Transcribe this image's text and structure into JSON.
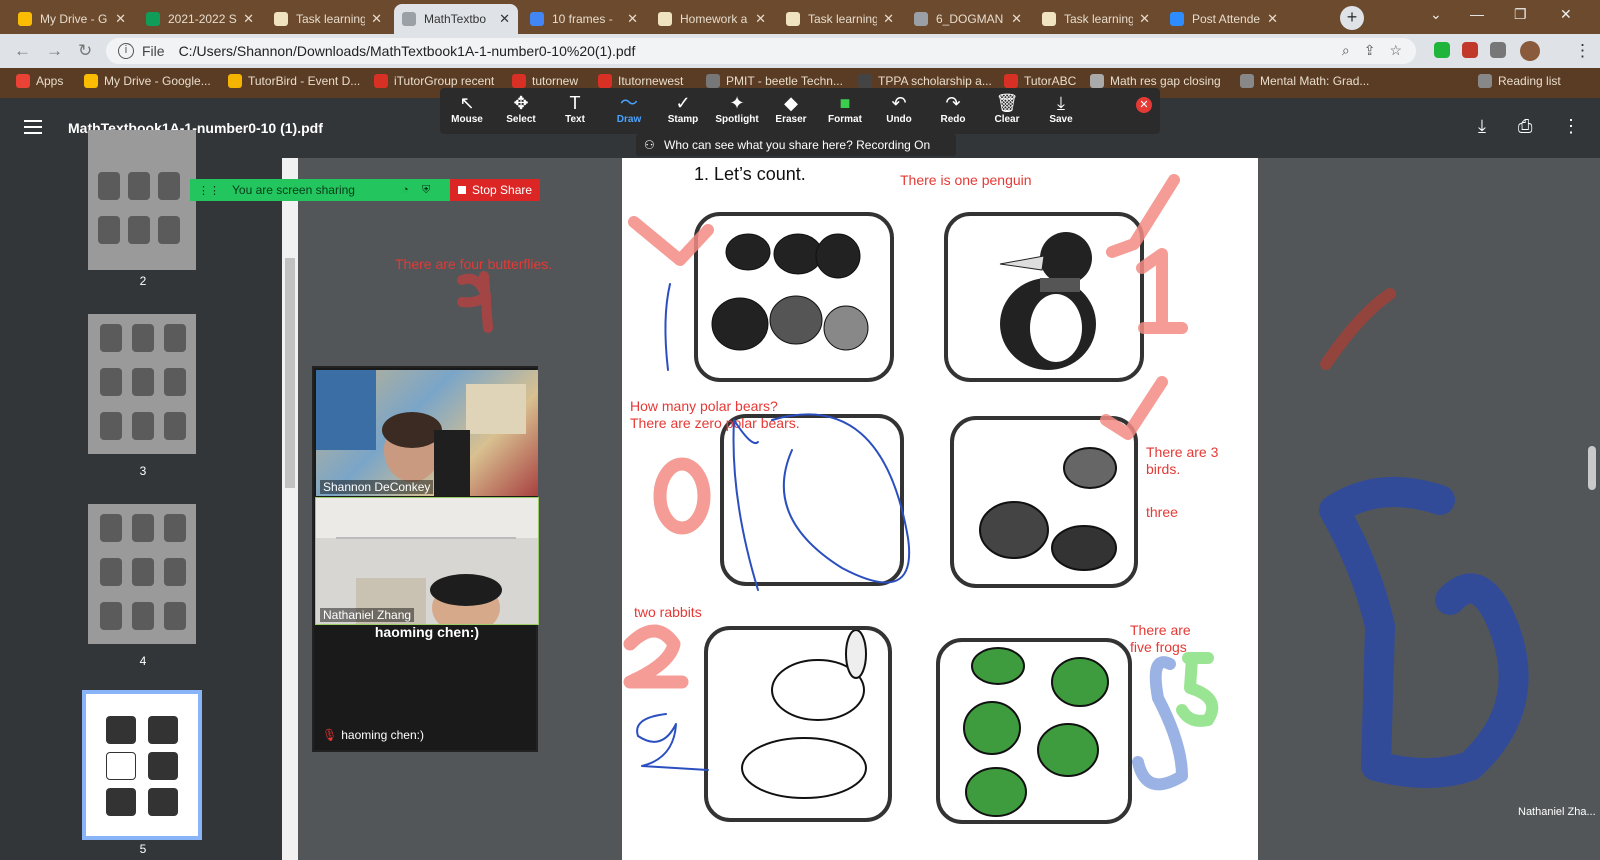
{
  "browser": {
    "tabs": [
      {
        "label": "My Drive - G",
        "color": "#fbbc04",
        "active": false
      },
      {
        "label": "2021-2022 S",
        "color": "#0f9d58",
        "active": false
      },
      {
        "label": "Task learning",
        "color": "#efe3c0",
        "active": false
      },
      {
        "label": "MathTextbo",
        "color": "#9aa0a6",
        "active": true
      },
      {
        "label": "10 frames -",
        "color": "#4285f4",
        "active": false
      },
      {
        "label": "Homework a",
        "color": "#efe3c0",
        "active": false
      },
      {
        "label": "Task learning",
        "color": "#efe3c0",
        "active": false
      },
      {
        "label": "6_DOGMAN",
        "color": "#9aa0a6",
        "active": false
      },
      {
        "label": "Task learning",
        "color": "#efe3c0",
        "active": false
      },
      {
        "label": "Post Attende",
        "color": "#2d8cff",
        "active": false
      }
    ],
    "new_tab": "+",
    "address": {
      "scheme": "File",
      "url": "C:/Users/Shannon/Downloads/MathTextbook1A-1-number0-10%20(1).pdf"
    },
    "bookmarks": [
      {
        "label": "Apps",
        "color": "#ea4335"
      },
      {
        "label": "My Drive - Google...",
        "color": "#fbbc04"
      },
      {
        "label": "TutorBird - Event D...",
        "color": "#f4b400"
      },
      {
        "label": "iTutorGroup recent",
        "color": "#d93025"
      },
      {
        "label": "tutornew",
        "color": "#d93025"
      },
      {
        "label": "Itutornewest",
        "color": "#d93025"
      },
      {
        "label": "PMIT - beetle Techn...",
        "color": "#777777"
      },
      {
        "label": "TPPA scholarship a...",
        "color": "#444444"
      },
      {
        "label": "TutorABC",
        "color": "#d93025"
      },
      {
        "label": "Math res gap closing",
        "color": "#aaaaaa"
      },
      {
        "label": "Mental Math: Grad...",
        "color": "#888888"
      },
      {
        "label": "Reading list",
        "color": "#888888"
      }
    ]
  },
  "pdf": {
    "title": "MathTextbook1A-1-number0-10 (1).pdf",
    "page_numbers": [
      "2",
      "3",
      "4",
      "5"
    ],
    "selected_page": "5"
  },
  "zoom": {
    "tools": [
      {
        "label": "Mouse",
        "glyph": "↖",
        "active": false
      },
      {
        "label": "Select",
        "glyph": "✥",
        "active": false
      },
      {
        "label": "Text",
        "glyph": "T",
        "active": false
      },
      {
        "label": "Draw",
        "glyph": "〜",
        "active": true
      },
      {
        "label": "Stamp",
        "glyph": "✓",
        "active": false
      },
      {
        "label": "Spotlight",
        "glyph": "✦",
        "active": false
      },
      {
        "label": "Eraser",
        "glyph": "◆",
        "active": false
      },
      {
        "label": "Format",
        "glyph": "■",
        "active": false
      },
      {
        "label": "Undo",
        "glyph": "↶",
        "active": false
      },
      {
        "label": "Redo",
        "glyph": "↷",
        "active": false
      },
      {
        "label": "Clear",
        "glyph": "🗑",
        "active": false
      },
      {
        "label": "Save",
        "glyph": "⤓",
        "active": false
      }
    ],
    "who_can_see": "Who can see what you share here? Recording On",
    "sharing_label": "You are screen sharing",
    "stop_share": "Stop Share",
    "participants": [
      "Shannon DeConkey",
      "Nathaniel Zhang"
    ],
    "no_video_name": "haoming chen:)",
    "no_video_label": "haoming chen:)",
    "floating_name": "Nathaniel Zha..."
  },
  "worksheet": {
    "heading": "1.    Let’s count.",
    "annotations": {
      "penguin": "There is one penguin",
      "butterflies": "There are four butterflies.",
      "polar_q": "How many polar bears?",
      "polar_a": "There are zero polar bears.",
      "birds_1": "There are 3",
      "birds_2": "birds.",
      "three": "three",
      "rabbits": "two rabbits",
      "frogs_1": "There are",
      "frogs_2": "five frogs"
    }
  }
}
